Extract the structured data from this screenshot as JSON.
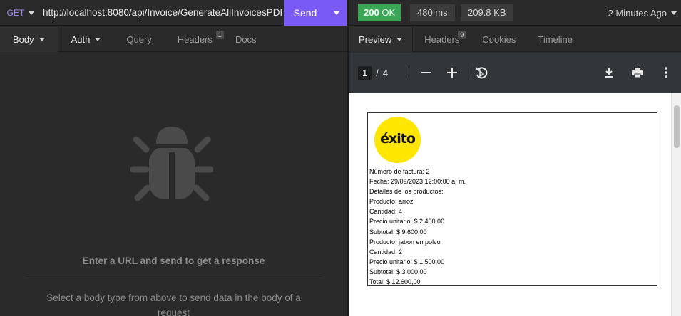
{
  "request": {
    "method": "GET",
    "url": "http://localhost:8080/api/Invoice/GenerateAllInvoicesPDF,",
    "send_label": "Send"
  },
  "response_meta": {
    "status_code": "200",
    "status_text": "OK",
    "time": "480 ms",
    "size": "209.8 KB",
    "ago": "2 Minutes Ago",
    "status_color": "#3aa655"
  },
  "left_tabs": [
    {
      "label": "Body"
    },
    {
      "label": "Auth"
    },
    {
      "label": "Query"
    },
    {
      "label": "Headers",
      "badge": "1"
    },
    {
      "label": "Docs"
    }
  ],
  "right_tabs": [
    {
      "label": "Preview"
    },
    {
      "label": "Headers",
      "badge": "9"
    },
    {
      "label": "Cookies"
    },
    {
      "label": "Timeline"
    }
  ],
  "empty_state": {
    "icon": "bug-icon",
    "title": "Enter a URL and send to get a response",
    "subtitle": "Select a body type from above to send data in the body of a request"
  },
  "pdf": {
    "current_page": "1",
    "page_sep": "/",
    "total_pages": "4",
    "logo_text": "éxito",
    "lines": [
      "Número de factura: 2",
      "Fecha: 29/09/2023 12:00:00 a. m.",
      "Detalles de los productos:",
      "Producto: arroz",
      "Cantidad: 4",
      "Precio unitario: $ 2.400,00",
      "Subtotal: $ 9.600,00",
      "Producto: jabon en polvo",
      "Cantidad: 2",
      "Precio unitario: $ 1.500,00",
      "Subtotal: $ 3.000,00",
      "Total: $ 12.600,00"
    ]
  },
  "colors": {
    "accent": "#7a5af5",
    "method": "#a78bfa",
    "logo_yellow": "#ffe600"
  }
}
